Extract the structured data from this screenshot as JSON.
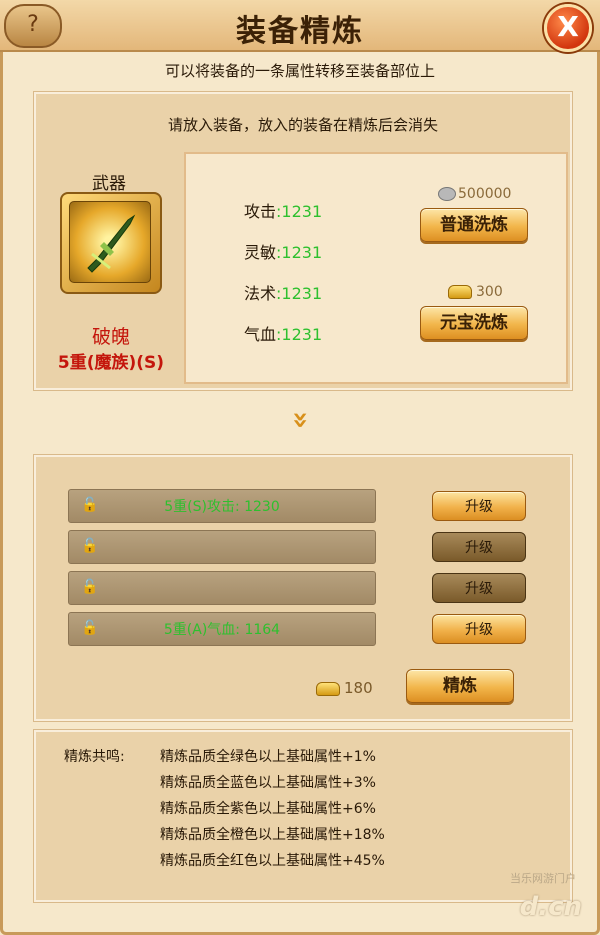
{
  "window": {
    "title": "装备精炼",
    "menu_glyph": "?",
    "close_glyph": "X"
  },
  "subtitle": "可以将装备的一条属性转移至装备部位上",
  "top": {
    "notice": "请放入装备，放入的装备在精炼后会消失",
    "weapon": {
      "label": "武器",
      "name": "破魄",
      "grade": "5重(魔族)(S)"
    },
    "stats": [
      {
        "name": "攻击",
        "sep": ":",
        "value": "1231"
      },
      {
        "name": "灵敏",
        "sep": ":",
        "value": "1231"
      },
      {
        "name": "法术",
        "sep": ":",
        "value": "1231"
      },
      {
        "name": "气血",
        "sep": ":",
        "value": "1231"
      }
    ],
    "normal_cost": "500000",
    "normal_btn": "普通洗炼",
    "ingot_cost": "300",
    "ingot_btn": "元宝洗炼"
  },
  "arrow": "»",
  "slots": [
    {
      "text": "5重(S)攻击: 1230",
      "upgrade": "升级",
      "enabled": true
    },
    {
      "text": "",
      "upgrade": "升级",
      "enabled": false
    },
    {
      "text": "",
      "upgrade": "升级",
      "enabled": false
    },
    {
      "text": "5重(A)气血: 1164",
      "upgrade": "升级",
      "enabled": true
    }
  ],
  "refine": {
    "cost": "180",
    "button": "精炼"
  },
  "resonance": {
    "label": "精炼共鸣:",
    "lines": [
      "精炼品质全绿色以上基础属性+1%",
      "精炼品质全蓝色以上基础属性+3%",
      "精炼品质全紫色以上基础属性+6%",
      "精炼品质全橙色以上基础属性+18%",
      "精炼品质全红色以上基础属性+45%"
    ]
  },
  "watermark": {
    "small": "当乐网游门户",
    "big": "d.cn"
  },
  "colors": {
    "stat_value": "#2ec02e",
    "grade_red": "#c4160c",
    "button_gold": "#f2b54a"
  }
}
